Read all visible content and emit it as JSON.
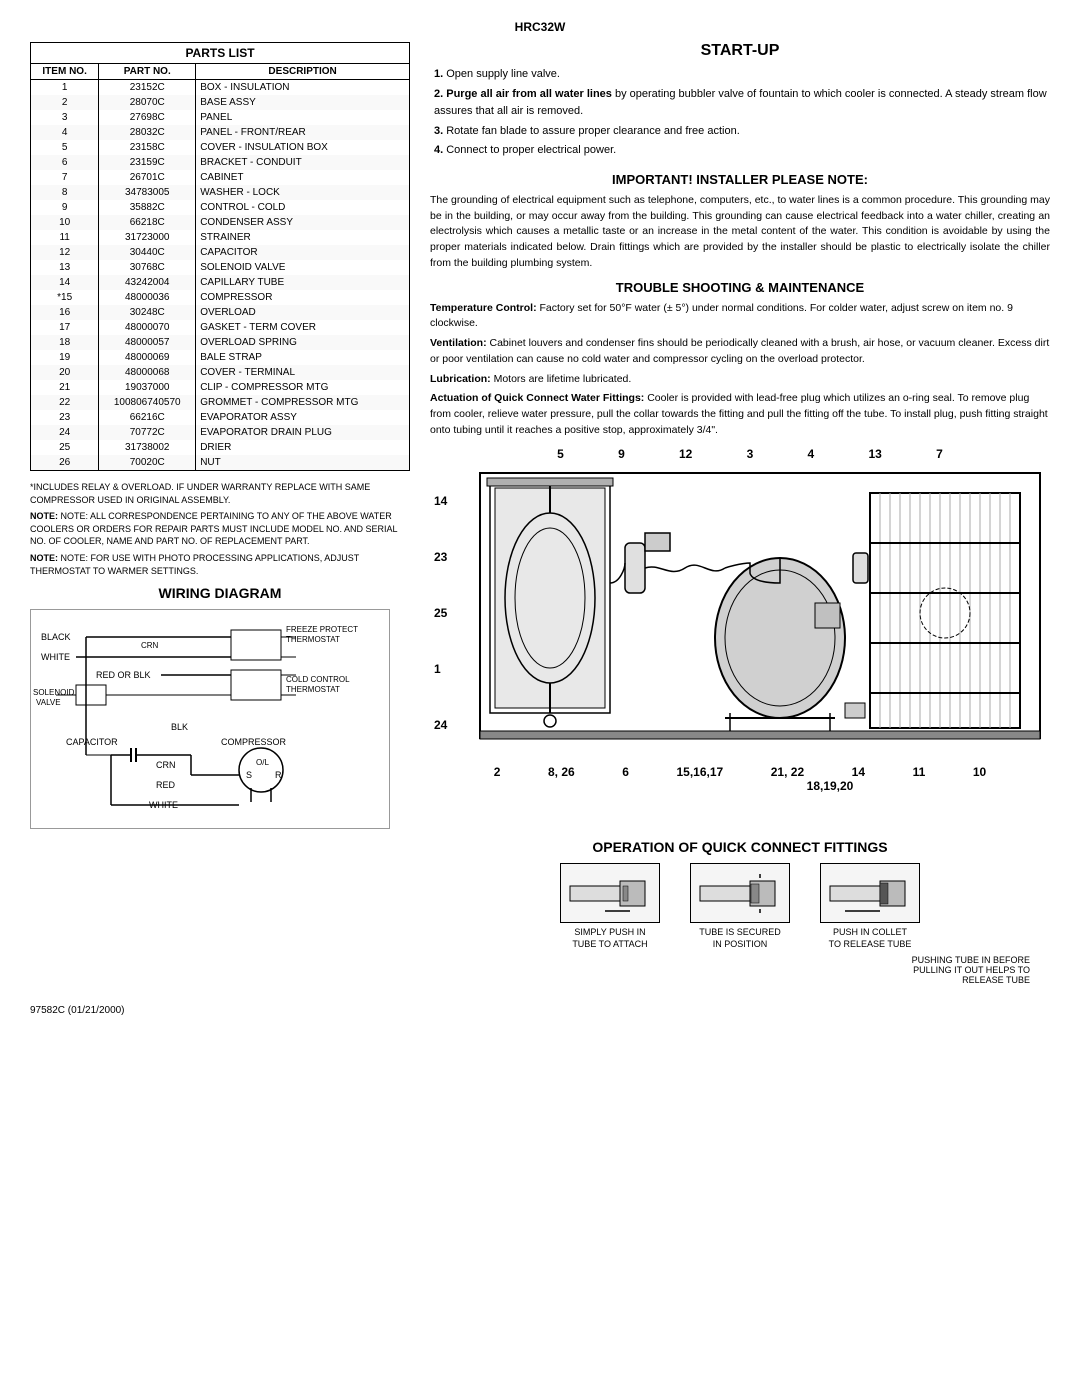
{
  "header": {
    "model": "HRC32W"
  },
  "parts_list": {
    "title": "PARTS LIST",
    "columns": [
      "ITEM NO.",
      "PART NO.",
      "DESCRIPTION"
    ],
    "rows": [
      [
        "1",
        "23152C",
        "BOX - INSULATION"
      ],
      [
        "2",
        "28070C",
        "BASE ASSY"
      ],
      [
        "3",
        "27698C",
        "PANEL"
      ],
      [
        "4",
        "28032C",
        "PANEL - FRONT/REAR"
      ],
      [
        "5",
        "23158C",
        "COVER - INSULATION BOX"
      ],
      [
        "6",
        "23159C",
        "BRACKET - CONDUIT"
      ],
      [
        "7",
        "26701C",
        "CABINET"
      ],
      [
        "8",
        "34783005",
        "WASHER - LOCK"
      ],
      [
        "9",
        "35882C",
        "CONTROL - COLD"
      ],
      [
        "10",
        "66218C",
        "CONDENSER ASSY"
      ],
      [
        "11",
        "31723000",
        "STRAINER"
      ],
      [
        "12",
        "30440C",
        "CAPACITOR"
      ],
      [
        "13",
        "30768C",
        "SOLENOID VALVE"
      ],
      [
        "14",
        "43242004",
        "CAPILLARY TUBE"
      ],
      [
        "*15",
        "48000036",
        "COMPRESSOR"
      ],
      [
        "16",
        "30248C",
        "OVERLOAD"
      ],
      [
        "17",
        "48000070",
        "GASKET - TERM COVER"
      ],
      [
        "18",
        "48000057",
        "OVERLOAD SPRING"
      ],
      [
        "19",
        "48000069",
        "BALE STRAP"
      ],
      [
        "20",
        "48000068",
        "COVER - TERMINAL"
      ],
      [
        "21",
        "19037000",
        "CLIP - COMPRESSOR MTG"
      ],
      [
        "22",
        "100806740570",
        "GROMMET - COMPRESSOR MTG"
      ],
      [
        "23",
        "66216C",
        "EVAPORATOR ASSY"
      ],
      [
        "24",
        "70772C",
        "EVAPORATOR DRAIN PLUG"
      ],
      [
        "25",
        "31738002",
        "DRIER"
      ],
      [
        "26",
        "70020C",
        "NUT"
      ]
    ]
  },
  "notes": {
    "note1": "*INCLUDES RELAY & OVERLOAD. IF UNDER WARRANTY REPLACE WITH SAME COMPRESSOR USED IN ORIGINAL ASSEMBLY.",
    "note2": "NOTE: ALL CORRESPONDENCE PERTAINING TO ANY OF THE ABOVE WATER COOLERS OR ORDERS FOR REPAIR PARTS MUST INCLUDE MODEL NO. AND SERIAL NO. OF COOLER, NAME AND PART NO. OF REPLACEMENT PART.",
    "note3": "NOTE: FOR USE WITH PHOTO PROCESSING APPLICATIONS, ADJUST THERMOSTAT TO WARMER SETTINGS."
  },
  "wiring": {
    "title": "WIRING DIAGRAM",
    "labels": {
      "black": "BLACK",
      "white": "WHITE",
      "red_or_blk": "RED OR BLK",
      "solenoid_valve": "SOLENOID VALVE",
      "freeze_protect": "FREEZE PROTECT THERMOSTAT",
      "cold_control": "COLD CONTROL THERMOSTAT",
      "capacitor": "CAPACITOR",
      "blk": "BLK",
      "compressor": "COMPRESSOR",
      "crn": "CRN",
      "red": "RED",
      "white2": "WHITE",
      "ol": "O/L",
      "s": "S",
      "r": "R"
    }
  },
  "startup": {
    "title": "START-UP",
    "items": [
      {
        "num": "1.",
        "bold": false,
        "text": "Open supply line valve."
      },
      {
        "num": "2.",
        "bold": true,
        "bold_text": "Purge all air from all water lines",
        "rest": " by operating bubbler valve of fountain to which cooler is connected. A steady stream flow assures that all air is removed."
      },
      {
        "num": "3.",
        "bold": false,
        "text": "Rotate fan blade to assure proper clearance and free action."
      },
      {
        "num": "4.",
        "bold": false,
        "text": "Connect to proper electrical power."
      }
    ]
  },
  "installer_note": {
    "title": "IMPORTANT! INSTALLER PLEASE NOTE:",
    "body": "The grounding of electrical equipment such as telephone, computers, etc., to water lines is a common procedure. This grounding may be in the building, or may occur away from the building. This grounding can cause electrical feedback into a water chiller, creating an electrolysis which causes a metallic taste or an increase in the metal content of the water. This condition is avoidable by using the proper materials indicated below. Drain fittings which are provided by the installer should be plastic to electrically isolate the chiller from the building plumbing system."
  },
  "trouble_shooting": {
    "title": "TROUBLE SHOOTING & MAINTENANCE",
    "items": [
      {
        "label": "Temperature Control:",
        "text": " Factory set for 50°F water (± 5°) under normal conditions. For colder water, adjust screw on item no. 9 clockwise."
      },
      {
        "label": "Ventilation:",
        "text": " Cabinet louvers and condenser fins should be periodically cleaned with a brush, air hose, or vacuum cleaner. Excess dirt or poor ventilation can cause no cold water and compressor cycling on the overload protector."
      },
      {
        "label": "Lubrication:",
        "text": " Motors are lifetime lubricated."
      },
      {
        "label": "Actuation of Quick Connect Water Fittings:",
        "text": " Cooler is provided with lead-free plug which utilizes an o-ring seal. To remove plug from cooler, relieve water pressure, pull the collar towards the fitting and pull the fitting off the tube. To install plug, push fitting straight onto tubing until it reaches a positive stop, approximately 3/4\"."
      }
    ]
  },
  "diagram": {
    "top_numbers": [
      "5",
      "9",
      "12",
      "3",
      "4",
      "13",
      "7"
    ],
    "side_numbers": [
      "14",
      "23",
      "25",
      "1",
      "24"
    ],
    "bottom_numbers": [
      "2",
      "8, 26",
      "6",
      "15,16,17",
      "21, 22",
      "14",
      "11",
      "10"
    ],
    "bottom_extra": "18,19,20"
  },
  "operation": {
    "title": "OPERATION OF QUICK CONNECT FITTINGS",
    "items": [
      {
        "label": "SIMPLY PUSH IN\nTUBE TO ATTACH"
      },
      {
        "label": "TUBE IS SECURED\nIN POSITION"
      },
      {
        "label": "PUSH IN COLLET\nTO RELEASE TUBE"
      }
    ],
    "note": "PUSHING TUBE IN BEFORE\nPULLING IT OUT HELPS TO\nRELEASE TUBE"
  },
  "footer": {
    "text": "97582C (01/21/2000)"
  }
}
